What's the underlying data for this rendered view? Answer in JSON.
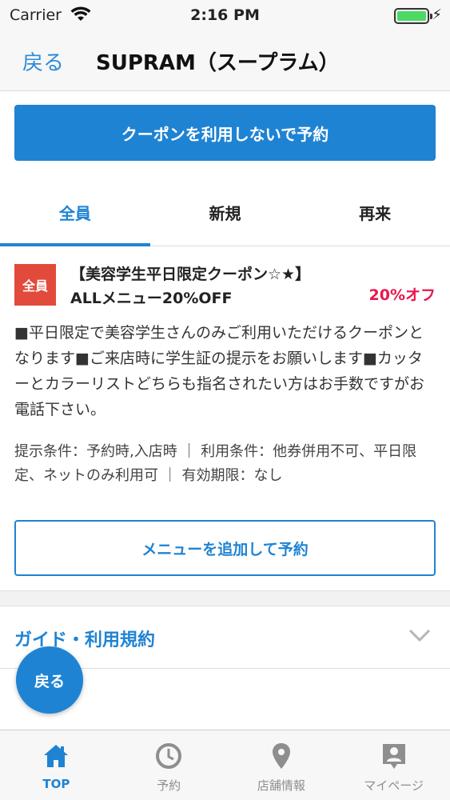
{
  "status_bar": {
    "carrier": "Carrier",
    "time": "2:16 PM"
  },
  "nav": {
    "back_label": "戻る",
    "title": "SUPRAM（スープラム）"
  },
  "primary_button": "クーポンを利用しないで予約",
  "tabs": [
    {
      "label": "全員",
      "active": true
    },
    {
      "label": "新規",
      "active": false
    },
    {
      "label": "再来",
      "active": false
    }
  ],
  "coupon": {
    "badge": "全員",
    "title_line1": "【美容学生平日限定クーポン☆★】",
    "title_line2": "ALLメニュー20%OFF",
    "discount": "20%オフ",
    "description": "■平日限定で美容学生さんのみご利用いただけるクーポンとなります■ご来店時に学生証の提示をお願いします■カッターとカラーリストどちらも指名されたい方はお手数ですがお電話下さい。",
    "conditions": "提示条件：予約時,入店時 ｜ 利用条件：他券併用不可、平日限定、ネットのみ利用可 ｜ 有効期限：なし",
    "add_menu_button": "メニューを追加して予約"
  },
  "guide": {
    "title": "ガイド・利用規約"
  },
  "floating_back": "戻る",
  "tab_bar": [
    {
      "label": "TOP",
      "icon": "home-icon",
      "active": true
    },
    {
      "label": "予約",
      "icon": "clock-icon",
      "active": false
    },
    {
      "label": "店舗情報",
      "icon": "location-pin-icon",
      "active": false
    },
    {
      "label": "マイページ",
      "icon": "profile-icon",
      "active": false
    }
  ],
  "colors": {
    "accent": "#1f83d3",
    "badge": "#e24a3b",
    "discount": "#e8174f"
  }
}
